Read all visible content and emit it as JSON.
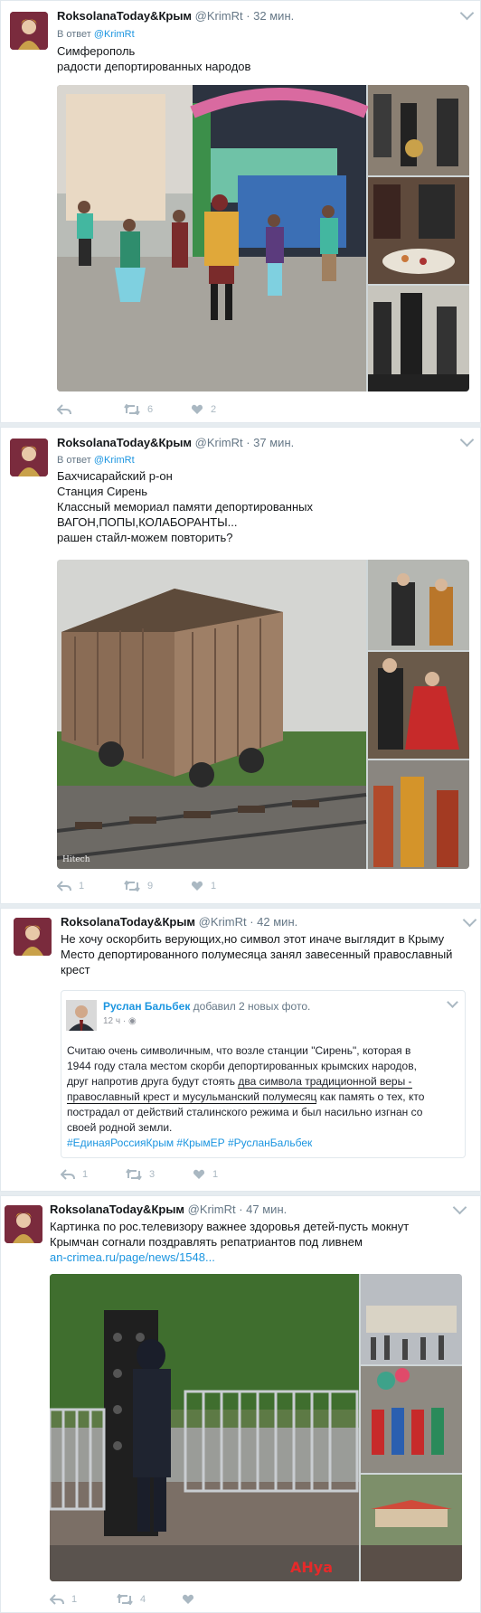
{
  "tweets": [
    {
      "author_name": "RoksolanaToday&Крым",
      "handle": "@KrimRt",
      "time": "32 мин.",
      "reply_label": "В ответ",
      "reply_handle": "@KrimRt",
      "lines": [
        "Симферополь",
        "радости депортированных народов"
      ],
      "replies": "",
      "retweets": "6",
      "likes": "2"
    },
    {
      "author_name": "RoksolanaToday&Крым",
      "handle": "@KrimRt",
      "time": "37 мин.",
      "reply_label": "В ответ",
      "reply_handle": "@KrimRt",
      "lines": [
        "Бахчисарайский р-он",
        "Станция Сирень",
        "Классный мемориал памяти депортированных",
        "ВАГОН,ПОПЫ,КОЛАБОРАНТЫ...",
        "рашен стайл-можем повторить?"
      ],
      "photo_watermark": "Hitech",
      "replies": "1",
      "retweets": "9",
      "likes": "1"
    },
    {
      "author_name": "RoksolanaToday&Крым",
      "handle": "@KrimRt",
      "time": "42 мин.",
      "lines": [
        "Не хочу оскорбить верующих,но символ этот иначе выглядит в Крыму",
        "Место депортированного полумесяца занял завесенный православный",
        "крест"
      ],
      "quote": {
        "name": "Руслан Бальбек",
        "added": "добавил 2 новых фото.",
        "time": "12 ч",
        "dot": "·",
        "text_lines": [
          "Считаю очень символичным, что возле станции \"Сирень\", которая в",
          "1944 году стала местом скорби депортированных крымских народов,",
          "друг напротив друга будут стоять ",
          "два символа традиционной веры -",
          "православный крест и мусульманский полумесяц",
          " как память о тех, кто",
          "пострадал от действий сталинского режима и был насильно изгнан со",
          "своей родной земли."
        ],
        "hashtags": "#ЕдинаяРоссияКрым #КрымЕР #РусланБальбек"
      },
      "replies": "1",
      "retweets": "3",
      "likes": "1"
    },
    {
      "author_name": "RoksolanaToday&Крым",
      "handle": "@KrimRt",
      "time": "47 мин.",
      "lines": [
        "Картинка по рос.телевизору важнее здоровья детей-пусть мокнут",
        "Крымчан согнали поздравлять репатриантов под ливнем"
      ],
      "link": "an-crimea.ru/page/news/1548...",
      "photo_watermark": "АНуа",
      "replies": "1",
      "retweets": "4",
      "likes": ""
    }
  ],
  "colors": {
    "background": "#e6ecf0",
    "link": "#1b95e0",
    "muted": "#657786",
    "icon": "#aab8c2"
  },
  "icons": [
    "reply-icon",
    "retweet-icon",
    "like-icon",
    "caret-down-icon"
  ]
}
